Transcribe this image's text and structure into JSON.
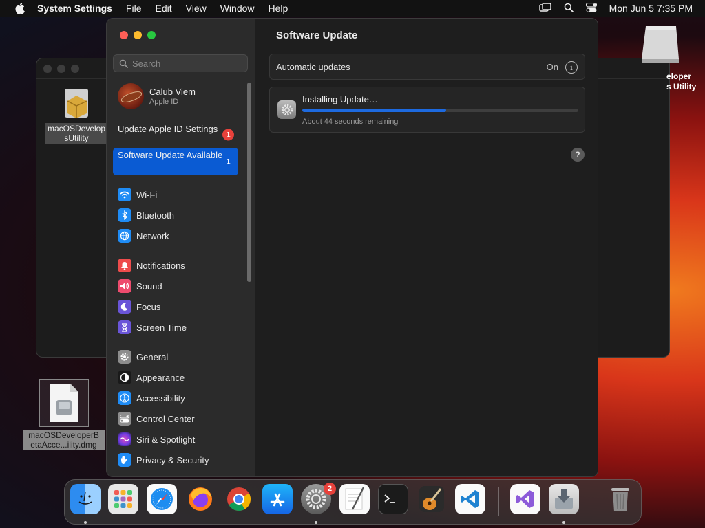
{
  "menubar": {
    "app_name": "System Settings",
    "items": [
      "File",
      "Edit",
      "View",
      "Window",
      "Help"
    ],
    "clock": "Mon Jun 5  7:35 PM"
  },
  "desktop": {
    "bg_window_file_label": "macOSDevelop sUtility",
    "bg_window_right_label": "eloper s Utility",
    "drive_label": "eloper\ns Utility",
    "dmg_label": "macOSDeveloperB etaAcce...ility.dmg"
  },
  "sidebar": {
    "search_placeholder": "Search",
    "account": {
      "name": "Calub Viem",
      "subtitle": "Apple ID"
    },
    "notices": [
      {
        "label": "Update Apple ID Settings",
        "badge": "1"
      },
      {
        "label": "Software Update Available",
        "badge": "1"
      }
    ],
    "groups": [
      [
        {
          "label": "Wi-Fi",
          "icon": "wifi-icon",
          "color": "#1f8cf5"
        },
        {
          "label": "Bluetooth",
          "icon": "bluetooth-icon",
          "color": "#1f8cf5"
        },
        {
          "label": "Network",
          "icon": "globe-icon",
          "color": "#1f8cf5"
        }
      ],
      [
        {
          "label": "Notifications",
          "icon": "bell-icon",
          "color": "#ee4c4c"
        },
        {
          "label": "Sound",
          "icon": "speaker-icon",
          "color": "#ee4c6e"
        },
        {
          "label": "Focus",
          "icon": "moon-icon",
          "color": "#6a55d8"
        },
        {
          "label": "Screen Time",
          "icon": "hourglass-icon",
          "color": "#6a55d8"
        }
      ],
      [
        {
          "label": "General",
          "icon": "gear-icon",
          "color": "#8d8d8d"
        },
        {
          "label": "Appearance",
          "icon": "appearance-icon",
          "color": "#1a1a1a"
        },
        {
          "label": "Accessibility",
          "icon": "accessibility-icon",
          "color": "#1f8cf5"
        },
        {
          "label": "Control Center",
          "icon": "switches-icon",
          "color": "#8d8d8d"
        },
        {
          "label": "Siri & Spotlight",
          "icon": "siri-icon",
          "color": "#b03ad8"
        },
        {
          "label": "Privacy & Security",
          "icon": "hand-icon",
          "color": "#1f8cf5"
        }
      ]
    ]
  },
  "content": {
    "title": "Software Update",
    "automatic_updates": {
      "label": "Automatic updates",
      "state": "On"
    },
    "install": {
      "title": "Installing Update…",
      "progress": 0.52,
      "remaining": "About 44 seconds remaining"
    }
  },
  "dock": {
    "items": [
      {
        "name": "finder",
        "running": true
      },
      {
        "name": "launchpad",
        "running": false
      },
      {
        "name": "safari",
        "running": false
      },
      {
        "name": "firefox",
        "running": false
      },
      {
        "name": "chrome",
        "running": false
      },
      {
        "name": "app-store",
        "running": false
      },
      {
        "name": "system-settings",
        "running": true,
        "badge": "2"
      },
      {
        "name": "textedit",
        "running": false
      },
      {
        "name": "terminal",
        "running": false
      },
      {
        "name": "garageband",
        "running": false
      },
      {
        "name": "vscode",
        "running": false
      },
      {
        "name": "visual-studio",
        "running": false
      },
      {
        "name": "installer",
        "running": true
      },
      {
        "name": "trash",
        "running": false
      }
    ]
  }
}
